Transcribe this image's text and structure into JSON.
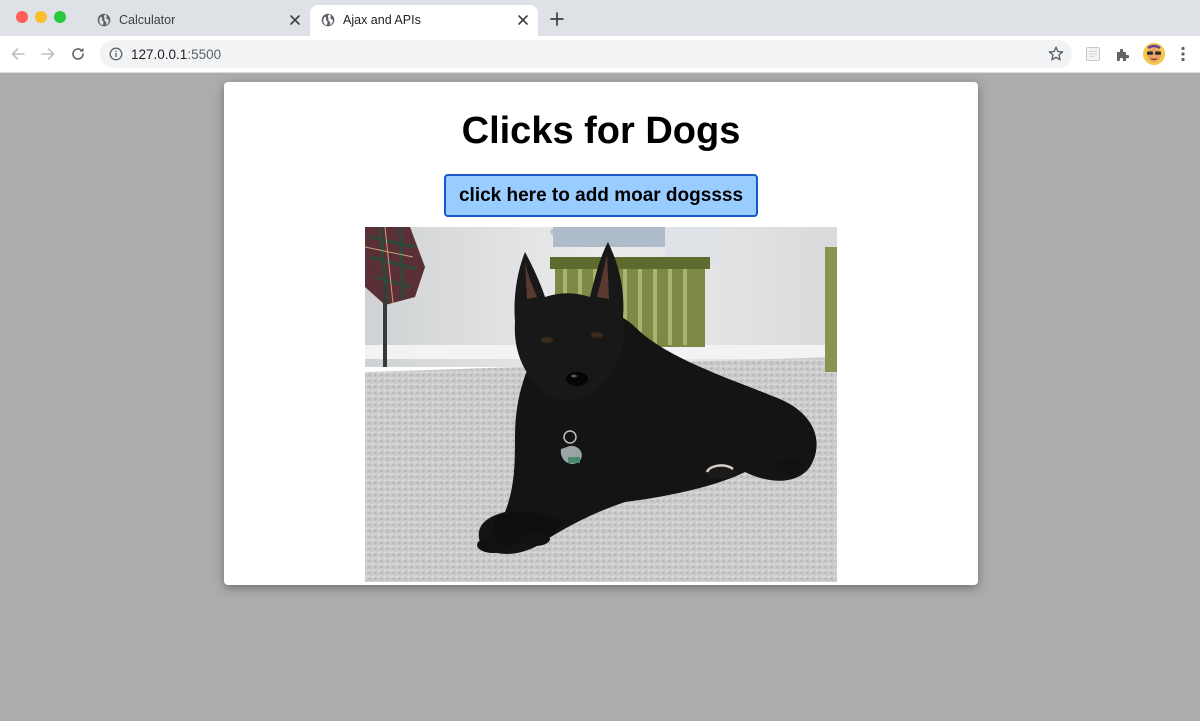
{
  "browser": {
    "tabs": [
      {
        "title": "Calculator",
        "active": false
      },
      {
        "title": "Ajax and APIs",
        "active": true
      }
    ],
    "url": {
      "host": "127.0.0.1",
      "port": ":5500"
    }
  },
  "page": {
    "heading": "Clicks for Dogs",
    "add_button_label": "click here to add moar dogssss",
    "button_color": "#99ccff",
    "button_border_color": "#1a57c7",
    "background_color": "#acacac"
  }
}
